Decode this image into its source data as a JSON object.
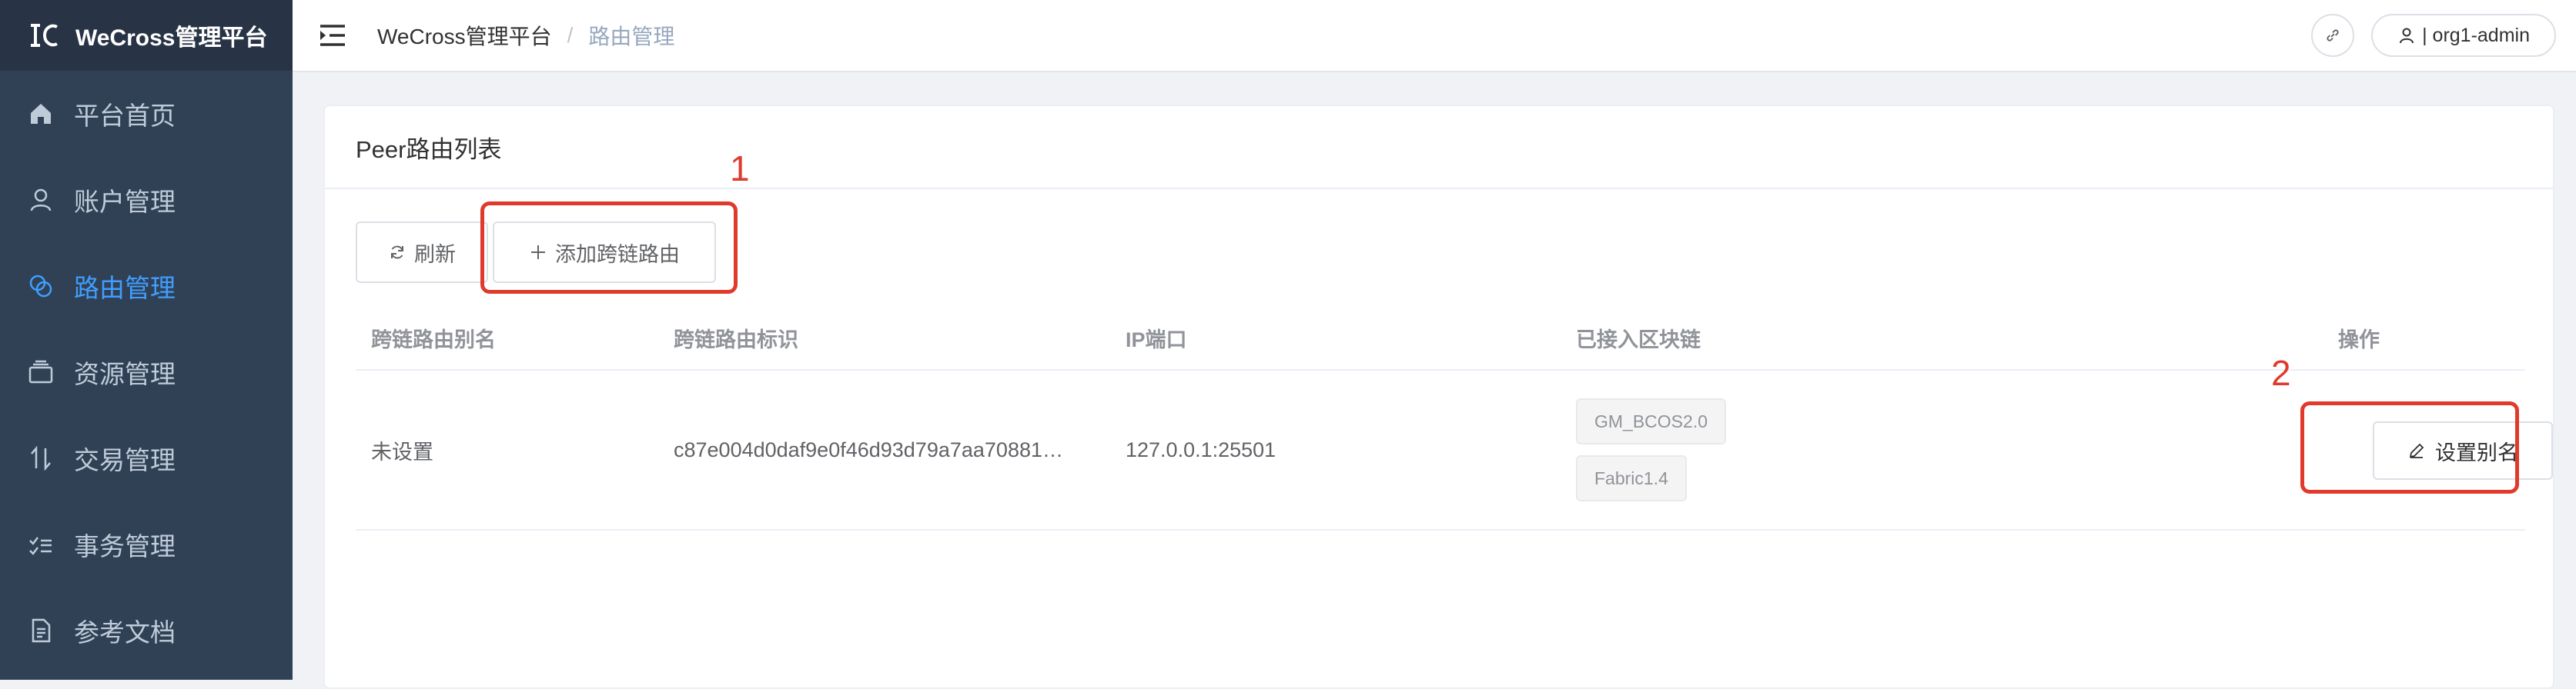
{
  "app": {
    "brand_title": "WeCross管理平台"
  },
  "sidebar": {
    "items": [
      {
        "label": "平台首页",
        "icon": "home-icon",
        "active": false
      },
      {
        "label": "账户管理",
        "icon": "user-icon",
        "active": false
      },
      {
        "label": "路由管理",
        "icon": "route-icon",
        "active": true
      },
      {
        "label": "资源管理",
        "icon": "resource-icon",
        "active": false
      },
      {
        "label": "交易管理",
        "icon": "transaction-icon",
        "active": false
      },
      {
        "label": "事务管理",
        "icon": "task-icon",
        "active": false
      },
      {
        "label": "参考文档",
        "icon": "document-icon",
        "active": false
      }
    ]
  },
  "header": {
    "breadcrumb": [
      "WeCross管理平台",
      "路由管理"
    ],
    "separator": "/",
    "user_label": "| org1-admin"
  },
  "card": {
    "title": "Peer路由列表",
    "refresh_label": "刷新",
    "add_label": "添加跨链路由"
  },
  "table": {
    "columns": [
      "跨链路由别名",
      "跨链路由标识",
      "IP端口",
      "已接入区块链",
      "操作"
    ],
    "rows": [
      {
        "alias": "未设置",
        "id": "c87e004d0daf9e0f46d93d79a7aa70881…",
        "ip_port": "127.0.0.1:25501",
        "chains": [
          "GM_BCOS2.0",
          "Fabric1.4"
        ],
        "action_label": "设置别名"
      }
    ]
  },
  "annotations": {
    "label1": "1",
    "label2": "2"
  },
  "colors": {
    "sidebar_bg": "#304156",
    "brand_bg": "#283446",
    "active": "#409eff",
    "annotation": "#e03a2c"
  }
}
